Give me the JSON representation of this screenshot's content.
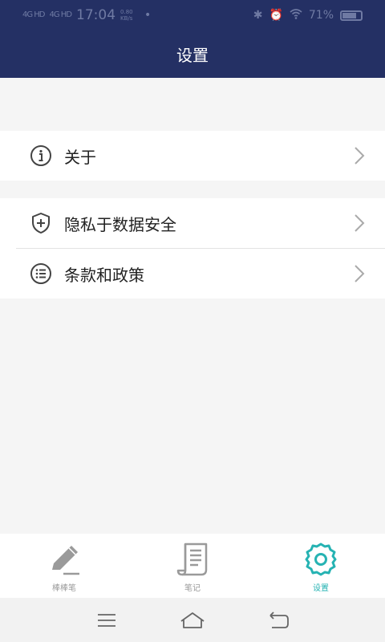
{
  "status_bar": {
    "signal1": "4G HD",
    "signal2": "4G HD",
    "time": "17:04",
    "speed": "0.80 KB/s",
    "battery": "71%",
    "battery_level": 0.71
  },
  "header": {
    "title": "设置"
  },
  "settings": {
    "groups": [
      {
        "items": [
          {
            "label": "关于",
            "icon": "info-icon"
          }
        ]
      },
      {
        "items": [
          {
            "label": "隐私于数据安全",
            "icon": "shield-plus-icon"
          },
          {
            "label": "条款和政策",
            "icon": "list-icon"
          }
        ]
      }
    ]
  },
  "tabbar": {
    "active_color": "#26b3b3",
    "items": [
      {
        "label": "棒棒笔",
        "icon": "pen-icon",
        "active": false
      },
      {
        "label": "笔记",
        "icon": "notes-icon",
        "active": false
      },
      {
        "label": "设置",
        "icon": "gear-icon",
        "active": true
      }
    ]
  },
  "navbar": {
    "buttons": [
      "menu-icon",
      "home-icon",
      "back-icon"
    ]
  },
  "colors": {
    "header_bg": "#243064",
    "accent": "#26b3b3",
    "page_bg": "#f5f5f5"
  }
}
